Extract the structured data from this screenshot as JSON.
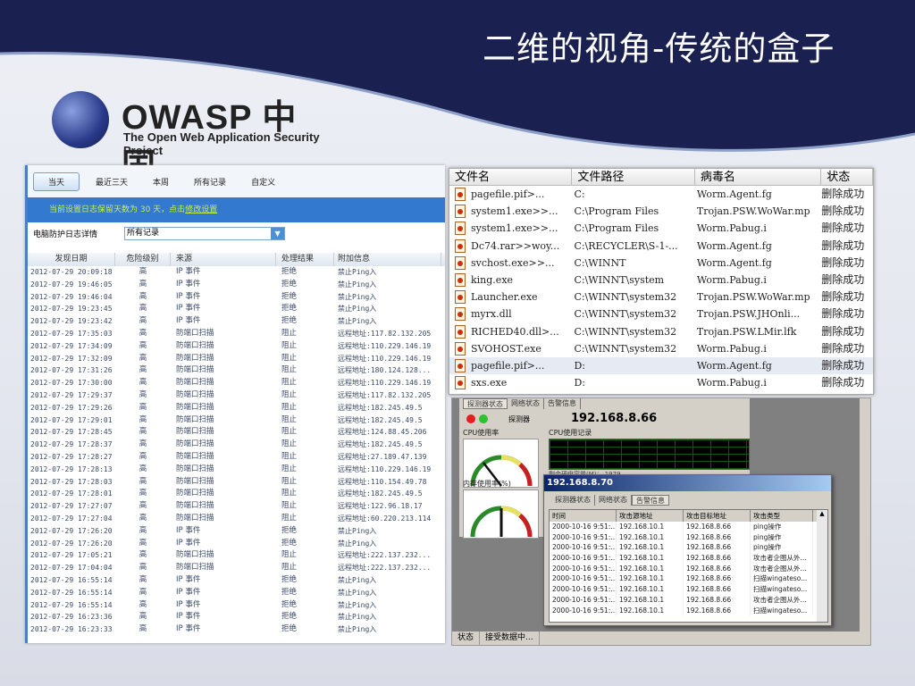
{
  "slide": {
    "title": "二维的视角-传统的盒子",
    "logo_name": "OWASP 中国",
    "logo_sub": "The Open Web Application Security Project",
    "accent": "#1a2150"
  },
  "log_panel": {
    "tabs": [
      "当天",
      "最近三天",
      "本周",
      "所有记录",
      "自定义"
    ],
    "notice_text": "当前设置日志保留天数为 30 天，点击",
    "notice_link": "修改设置",
    "filter_label": "电脑防护日志详情",
    "filter_value": "所有记录",
    "columns": [
      "发现日期",
      "危险级别",
      "来源",
      "处理结果",
      "附加信息"
    ],
    "rows": [
      [
        "2012-07-29 20:09:18",
        "高",
        "IP 事件",
        "拒绝",
        "禁止Ping入"
      ],
      [
        "2012-07-29 19:46:05",
        "高",
        "IP 事件",
        "拒绝",
        "禁止Ping入"
      ],
      [
        "2012-07-29 19:46:04",
        "高",
        "IP 事件",
        "拒绝",
        "禁止Ping入"
      ],
      [
        "2012-07-29 19:23:45",
        "高",
        "IP 事件",
        "拒绝",
        "禁止Ping入"
      ],
      [
        "2012-07-29 19:23:42",
        "高",
        "IP 事件",
        "拒绝",
        "禁止Ping入"
      ],
      [
        "2012-07-29 17:35:03",
        "高",
        "防端口扫描",
        "阻止",
        "远程地址:117.82.132.205"
      ],
      [
        "2012-07-29 17:34:09",
        "高",
        "防端口扫描",
        "阻止",
        "远程地址:110.229.146.19"
      ],
      [
        "2012-07-29 17:32:09",
        "高",
        "防端口扫描",
        "阻止",
        "远程地址:110.229.146.19"
      ],
      [
        "2012-07-29 17:31:26",
        "高",
        "防端口扫描",
        "阻止",
        "远程地址:180.124.128..."
      ],
      [
        "2012-07-29 17:30:00",
        "高",
        "防端口扫描",
        "阻止",
        "远程地址:110.229.146.19"
      ],
      [
        "2012-07-29 17:29:37",
        "高",
        "防端口扫描",
        "阻止",
        "远程地址:117.82.132.205"
      ],
      [
        "2012-07-29 17:29:26",
        "高",
        "防端口扫描",
        "阻止",
        "远程地址:182.245.49.5"
      ],
      [
        "2012-07-29 17:29:01",
        "高",
        "防端口扫描",
        "阻止",
        "远程地址:182.245.49.5"
      ],
      [
        "2012-07-29 17:28:45",
        "高",
        "防端口扫描",
        "阻止",
        "远程地址:124.88.45.206"
      ],
      [
        "2012-07-29 17:28:37",
        "高",
        "防端口扫描",
        "阻止",
        "远程地址:182.245.49.5"
      ],
      [
        "2012-07-29 17:28:27",
        "高",
        "防端口扫描",
        "阻止",
        "远程地址:27.189.47.139"
      ],
      [
        "2012-07-29 17:28:13",
        "高",
        "防端口扫描",
        "阻止",
        "远程地址:110.229.146.19"
      ],
      [
        "2012-07-29 17:28:03",
        "高",
        "防端口扫描",
        "阻止",
        "远程地址:110.154.49.78"
      ],
      [
        "2012-07-29 17:28:01",
        "高",
        "防端口扫描",
        "阻止",
        "远程地址:182.245.49.5"
      ],
      [
        "2012-07-29 17:27:07",
        "高",
        "防端口扫描",
        "阻止",
        "远程地址:122.96.18.17"
      ],
      [
        "2012-07-29 17:27:04",
        "高",
        "防端口扫描",
        "阻止",
        "远程地址:60.220.213.114"
      ],
      [
        "2012-07-29 17:26:20",
        "高",
        "IP 事件",
        "拒绝",
        "禁止Ping入"
      ],
      [
        "2012-07-29 17:26:20",
        "高",
        "IP 事件",
        "拒绝",
        "禁止Ping入"
      ],
      [
        "2012-07-29 17:05:21",
        "高",
        "防端口扫描",
        "阻止",
        "远程地址:222.137.232..."
      ],
      [
        "2012-07-29 17:04:04",
        "高",
        "防端口扫描",
        "阻止",
        "远程地址:222.137.232..."
      ],
      [
        "2012-07-29 16:55:14",
        "高",
        "IP 事件",
        "拒绝",
        "禁止Ping入"
      ],
      [
        "2012-07-29 16:55:14",
        "高",
        "IP 事件",
        "拒绝",
        "禁止Ping入"
      ],
      [
        "2012-07-29 16:55:14",
        "高",
        "IP 事件",
        "拒绝",
        "禁止Ping入"
      ],
      [
        "2012-07-29 16:23:36",
        "高",
        "IP 事件",
        "拒绝",
        "禁止Ping入"
      ],
      [
        "2012-07-29 16:23:33",
        "高",
        "IP 事件",
        "拒绝",
        "禁止Ping入"
      ]
    ]
  },
  "virus_panel": {
    "columns": [
      "文件名",
      "文件路径",
      "病毒名",
      "状态"
    ],
    "rows": [
      [
        "pagefile.pif>...",
        "C:",
        "Worm.Agent.fg",
        "删除成功"
      ],
      [
        "system1.exe>>...",
        "C:\\Program Files",
        "Trojan.PSW.WoWar.mp",
        "删除成功"
      ],
      [
        "system1.exe>>...",
        "C:\\Program Files",
        "Worm.Pabug.i",
        "删除成功"
      ],
      [
        "Dc74.rar>>woy...",
        "C:\\RECYCLER\\S-1-...",
        "Worm.Agent.fg",
        "删除成功"
      ],
      [
        "svchost.exe>>...",
        "C:\\WINNT",
        "Worm.Agent.fg",
        "删除成功"
      ],
      [
        "king.exe",
        "C:\\WINNT\\system",
        "Worm.Pabug.i",
        "删除成功"
      ],
      [
        "Launcher.exe",
        "C:\\WINNT\\system32",
        "Trojan.PSW.WoWar.mp",
        "删除成功"
      ],
      [
        "myrx.dll",
        "C:\\WINNT\\system32",
        "Trojan.PSW.JHOnli...",
        "删除成功"
      ],
      [
        "RICHED40.dll>...",
        "C:\\WINNT\\system32",
        "Trojan.PSW.LMir.lfk",
        "删除成功"
      ],
      [
        "SVOHOST.exe",
        "C:\\WINNT\\system32",
        "Worm.Pabug.i",
        "删除成功"
      ],
      [
        "pagefile.pif>...",
        "D:",
        "Worm.Agent.fg",
        "删除成功"
      ],
      [
        "sxs.exe",
        "D:",
        "Worm.Pabug.i",
        "删除成功"
      ]
    ],
    "selected_row": 10
  },
  "monitor": {
    "tabs": [
      "探测器状态",
      "网络状态",
      "告警信息"
    ],
    "detector_label": "探测器",
    "detector_ip": "192.168.8.66",
    "cpu_label": "CPU使用率",
    "cpu_history_label": "CPU使用记录",
    "mem_label": "内存使用率(%)",
    "mem_capacity": "剩余硬盘容量(M)：   1979",
    "gauge_ticks": [
      "0",
      "25",
      "50",
      "75",
      "100"
    ],
    "popup": {
      "title": "192.168.8.70",
      "tabs": [
        "探测器状态",
        "网络状态",
        "告警信息"
      ],
      "active_tab": 2,
      "columns": [
        "时间",
        "攻击源地址",
        "攻击目标地址",
        "攻击类型"
      ],
      "rows": [
        [
          "2000-10-16 9:51:...",
          "192.168.10.1",
          "192.168.8.66",
          "ping操作"
        ],
        [
          "2000-10-16 9:51:...",
          "192.168.10.1",
          "192.168.8.66",
          "ping操作"
        ],
        [
          "2000-10-16 9:51:...",
          "192.168.10.1",
          "192.168.8.66",
          "ping操作"
        ],
        [
          "2000-10-16 9:51:...",
          "192.168.10.1",
          "192.168.8.66",
          "攻击者企图从外..."
        ],
        [
          "2000-10-16 9:51:...",
          "192.168.10.1",
          "192.168.8.66",
          "攻击者企图从外..."
        ],
        [
          "2000-10-16 9:51:...",
          "192.168.10.1",
          "192.168.8.66",
          "扫描wingateso..."
        ],
        [
          "2000-10-16 9:51:...",
          "192.168.10.1",
          "192.168.8.66",
          "扫描wingateso..."
        ],
        [
          "2000-10-16 9:51:...",
          "192.168.10.1",
          "192.168.8.66",
          "攻击者企图从外..."
        ],
        [
          "2000-10-16 9:51:...",
          "192.168.10.1",
          "192.168.8.66",
          "扫描wingateso..."
        ]
      ]
    },
    "status_label": "状态",
    "status_text": "接受数据中..."
  }
}
